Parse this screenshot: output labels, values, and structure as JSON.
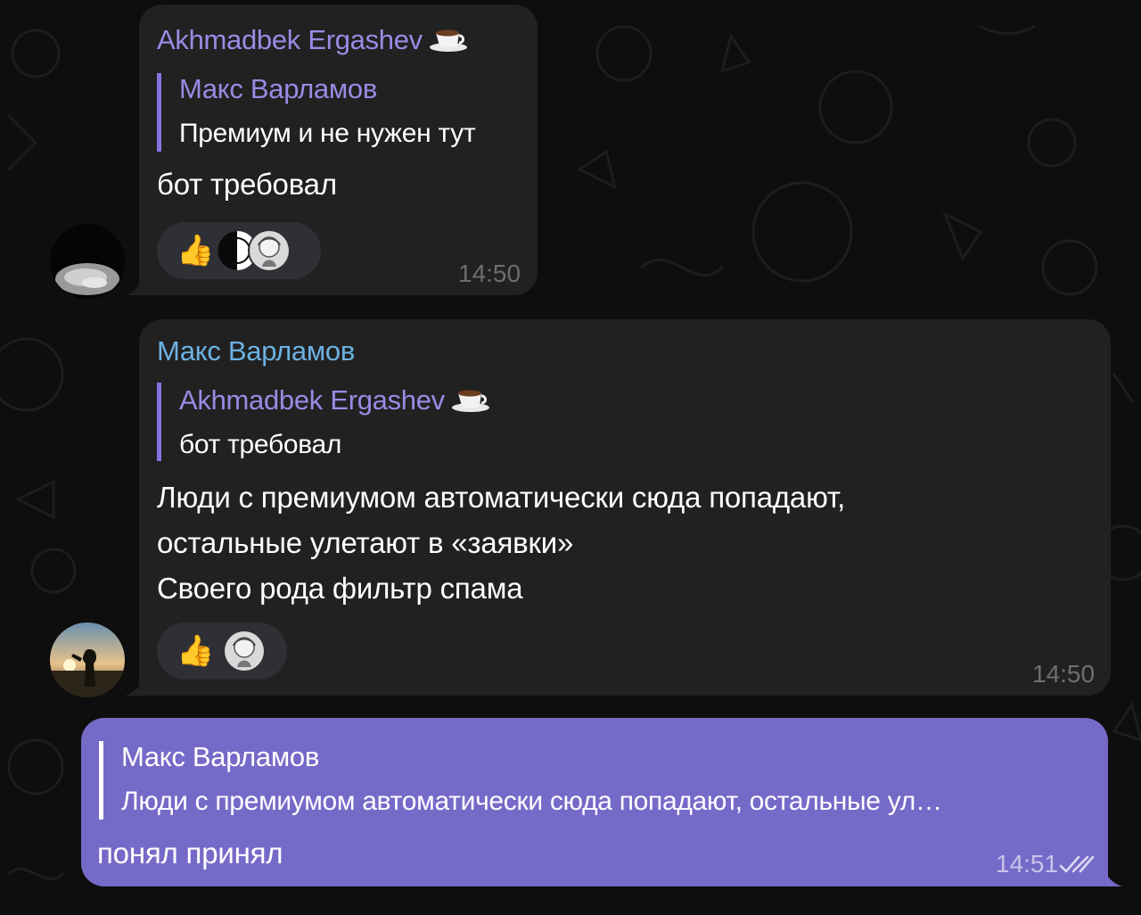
{
  "colors": {
    "background": "#0e0e0e",
    "incoming_bubble": "#212121",
    "outgoing_bubble": "#766ac8",
    "name_purple": "#9b8ae5",
    "name_blue": "#6cb2e4",
    "reply_bar": "#8774e1",
    "time_gray": "#6e6e70"
  },
  "messages": [
    {
      "sender": "Akhmadbek Ergashev",
      "sender_icon": "coffee-emoji-icon",
      "reply": {
        "name": "Макс Варламов",
        "text": "Премиум и не нужен тут"
      },
      "lines": [
        "бот требовал"
      ],
      "reactions": {
        "emoji": "👍",
        "reactor_icons": [
          "half-moon-avatar-icon",
          "anime-girl-avatar-icon"
        ]
      },
      "time": "14:50"
    },
    {
      "sender": "Макс Варламов",
      "reply": {
        "name": "Akhmadbek Ergashev",
        "name_icon": "coffee-emoji-icon",
        "text": "бот требовал"
      },
      "lines": [
        "Люди с премиумом автоматически сюда попадают,",
        "остальные улетают в «заявки»",
        "Своего рода фильтр спама"
      ],
      "reactions": {
        "emoji": "👍",
        "reactor_icons": [
          "anime-girl-avatar-icon"
        ]
      },
      "time": "14:50"
    },
    {
      "outgoing": true,
      "reply": {
        "name": "Макс Варламов",
        "text": "Люди с премиумом автоматически сюда попадают, остальные ул…"
      },
      "lines": [
        "понял принял"
      ],
      "time": "14:51",
      "status_icon": "double-check-icon"
    }
  ]
}
